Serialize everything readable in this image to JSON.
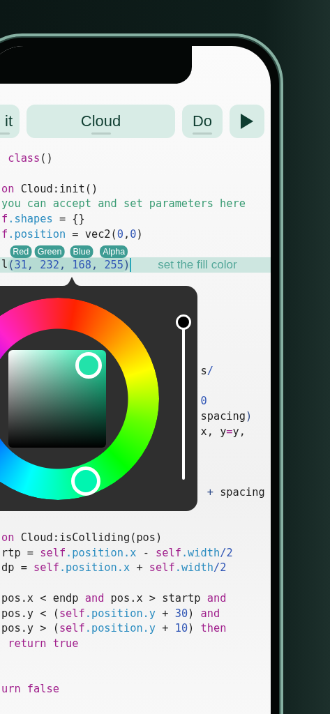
{
  "tabs": [
    {
      "label": "it"
    },
    {
      "label": "Cloud"
    },
    {
      "label": "Do"
    }
  ],
  "code_lines": [
    {
      "kind": "code",
      "tokens": [
        {
          "text": " class",
          "kind": "keyword"
        },
        {
          "text": "()",
          "kind": "plain"
        }
      ]
    },
    {
      "kind": "blank"
    },
    {
      "kind": "code",
      "tokens": [
        {
          "text": "on",
          "kind": "keyword"
        },
        {
          "text": " Cloud:init()",
          "kind": "plain"
        }
      ]
    },
    {
      "kind": "code",
      "tokens": [
        {
          "text": "you can accept and set parameters here",
          "kind": "comment"
        }
      ]
    },
    {
      "kind": "code",
      "tokens": [
        {
          "text": "f",
          "kind": "keyword"
        },
        {
          "text": ".shapes",
          "kind": "member"
        },
        {
          "text": " = {}",
          "kind": "plain"
        }
      ]
    },
    {
      "kind": "code",
      "tokens": [
        {
          "text": "f",
          "kind": "keyword"
        },
        {
          "text": ".position",
          "kind": "member"
        },
        {
          "text": " = vec2(",
          "kind": "plain"
        },
        {
          "text": "0",
          "kind": "number"
        },
        {
          "text": ",",
          "kind": "plain"
        },
        {
          "text": "0",
          "kind": "number"
        },
        {
          "text": ")",
          "kind": "plain"
        }
      ]
    },
    {
      "kind": "blank"
    },
    {
      "kind": "color-call",
      "tokens": [
        {
          "text": "l",
          "kind": "plain"
        }
      ],
      "call_tokens": [
        {
          "text": "(",
          "kind": "paren"
        },
        {
          "text": "31",
          "kind": "number",
          "label": "Red"
        },
        {
          "text": ", ",
          "kind": "paren"
        },
        {
          "text": "232",
          "kind": "number",
          "label": "Green"
        },
        {
          "text": ", ",
          "kind": "paren"
        },
        {
          "text": "168",
          "kind": "number",
          "label": "Blue"
        },
        {
          "text": ", ",
          "kind": "paren"
        },
        {
          "text": "255",
          "kind": "number",
          "label": "Alpha"
        },
        {
          "text": ")",
          "kind": "paren"
        }
      ],
      "hint": "set the fill color"
    },
    {
      "kind": "blank"
    },
    {
      "kind": "blank"
    },
    {
      "kind": "blank"
    },
    {
      "kind": "blank"
    },
    {
      "kind": "blank"
    },
    {
      "kind": "blank"
    },
    {
      "kind": "code",
      "tokens": [
        {
          "text": "                               s",
          "kind": "plain"
        },
        {
          "text": "/",
          "kind": "number"
        }
      ]
    },
    {
      "kind": "blank"
    },
    {
      "kind": "code",
      "tokens": [
        {
          "text": "                               0",
          "kind": "number"
        }
      ]
    },
    {
      "kind": "code",
      "tokens": [
        {
          "text": "                               spacing",
          "kind": "plain"
        },
        {
          "text": ")",
          "kind": "paren"
        }
      ]
    },
    {
      "kind": "code",
      "tokens": [
        {
          "text": "                               x, y",
          "kind": "plain"
        },
        {
          "text": "=",
          "kind": "keyword"
        },
        {
          "text": "y,",
          "kind": "plain"
        }
      ]
    },
    {
      "kind": "blank"
    },
    {
      "kind": "blank"
    },
    {
      "kind": "blank"
    },
    {
      "kind": "code",
      "tokens": [
        {
          "text": "                                +",
          "kind": "paren"
        },
        {
          "text": " spacing",
          "kind": "plain"
        }
      ]
    },
    {
      "kind": "blank"
    },
    {
      "kind": "blank"
    },
    {
      "kind": "code",
      "tokens": [
        {
          "text": "on",
          "kind": "keyword"
        },
        {
          "text": " Cloud:isColliding(pos)",
          "kind": "plain"
        }
      ]
    },
    {
      "kind": "code",
      "tokens": [
        {
          "text": "rtp = ",
          "kind": "plain"
        },
        {
          "text": "self",
          "kind": "keyword"
        },
        {
          "text": ".position.x",
          "kind": "member"
        },
        {
          "text": " - ",
          "kind": "plain"
        },
        {
          "text": "self",
          "kind": "keyword"
        },
        {
          "text": ".width",
          "kind": "member"
        },
        {
          "text": "/2",
          "kind": "number"
        }
      ]
    },
    {
      "kind": "code",
      "tokens": [
        {
          "text": "dp = ",
          "kind": "plain"
        },
        {
          "text": "self",
          "kind": "keyword"
        },
        {
          "text": ".position.x",
          "kind": "member"
        },
        {
          "text": " + ",
          "kind": "plain"
        },
        {
          "text": "self",
          "kind": "keyword"
        },
        {
          "text": ".width",
          "kind": "member"
        },
        {
          "text": "/2",
          "kind": "number"
        }
      ]
    },
    {
      "kind": "blank"
    },
    {
      "kind": "code",
      "tokens": [
        {
          "text": "pos.x < endp ",
          "kind": "plain"
        },
        {
          "text": "and",
          "kind": "keyword"
        },
        {
          "text": " pos.x > startp ",
          "kind": "plain"
        },
        {
          "text": "and",
          "kind": "keyword"
        }
      ]
    },
    {
      "kind": "code",
      "tokens": [
        {
          "text": "pos.y < (",
          "kind": "plain"
        },
        {
          "text": "self",
          "kind": "keyword"
        },
        {
          "text": ".position.y",
          "kind": "member"
        },
        {
          "text": " + ",
          "kind": "plain"
        },
        {
          "text": "30",
          "kind": "number"
        },
        {
          "text": ") ",
          "kind": "plain"
        },
        {
          "text": "and",
          "kind": "keyword"
        }
      ]
    },
    {
      "kind": "code",
      "tokens": [
        {
          "text": "pos.y > (",
          "kind": "plain"
        },
        {
          "text": "self",
          "kind": "keyword"
        },
        {
          "text": ".position.y",
          "kind": "member"
        },
        {
          "text": " + ",
          "kind": "plain"
        },
        {
          "text": "10",
          "kind": "number"
        },
        {
          "text": ") ",
          "kind": "plain"
        },
        {
          "text": "then",
          "kind": "keyword"
        }
      ]
    },
    {
      "kind": "code",
      "tokens": [
        {
          "text": " return true",
          "kind": "keyword"
        }
      ]
    },
    {
      "kind": "blank"
    },
    {
      "kind": "blank"
    },
    {
      "kind": "code",
      "tokens": [
        {
          "text": "urn false",
          "kind": "keyword"
        }
      ]
    }
  ],
  "color_picker": {
    "slider": {
      "level": 1
    }
  }
}
